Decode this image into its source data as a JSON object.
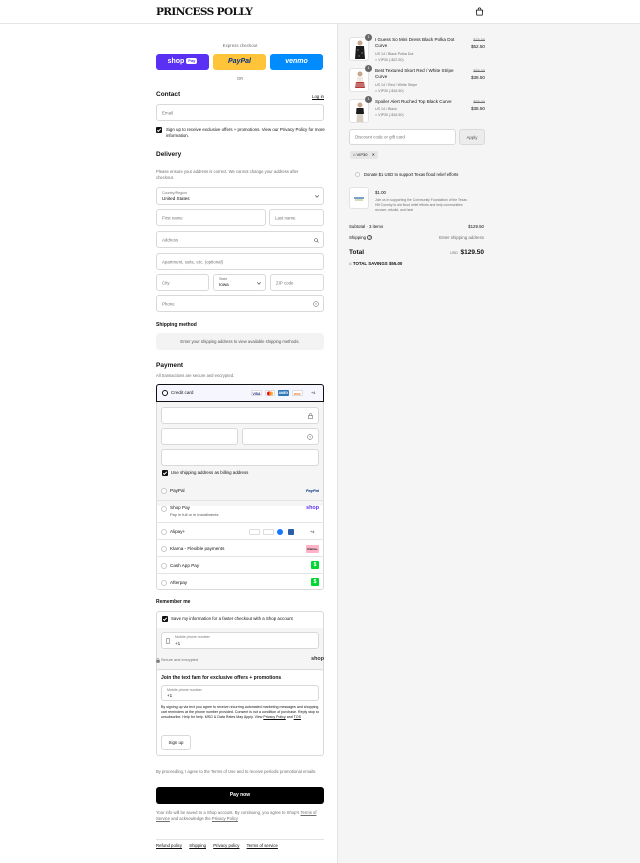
{
  "brand": {
    "logo": "PRINCESS POLLY"
  },
  "express": {
    "label": "Express checkout",
    "shop_pay": "shop",
    "shop_pay_badge": "Pay",
    "paypal": "PayPal",
    "venmo": "venmo",
    "or": "OR"
  },
  "contact": {
    "title": "Contact",
    "login": "Log in",
    "email_placeholder": "Email",
    "newsletter": "Sign up to receive exclusive offers + promotions. View our Privacy Policy for more information."
  },
  "delivery": {
    "title": "Delivery",
    "note": "Please ensure your address is correct. We cannot change your address after checkout.",
    "country_label": "Country/Region",
    "country_value": "United States",
    "first_name": "First name",
    "last_name": "Last name",
    "address": "Address",
    "apartment": "Apartment, suite, etc. (optional)",
    "city": "City",
    "state_label": "State",
    "state_value": "Iowa",
    "zip": "ZIP code",
    "phone": "Phone"
  },
  "shipping": {
    "title": "Shipping method",
    "placeholder": "Enter your shipping address to view available shipping methods."
  },
  "payment": {
    "title": "Payment",
    "note": "All transactions are secure and encrypted.",
    "credit_card": "Credit card",
    "card_badges": [
      "VISA",
      "MC",
      "AMEX",
      "DISC"
    ],
    "more_cards": "+4",
    "billing_same": "Use shipping address as billing address",
    "methods": [
      {
        "name": "PayPal",
        "badge": "PayPal"
      },
      {
        "name": "Shop Pay",
        "sub": "Pay in full or in installments",
        "badge": "shop"
      },
      {
        "name": "Alipay+",
        "more": "+4"
      },
      {
        "name": "Klarna - Flexible payments",
        "badge": "Klarna."
      },
      {
        "name": "Cash App Pay",
        "badge": "$"
      },
      {
        "name": "Afterpay",
        "badge": "$"
      }
    ]
  },
  "remember": {
    "title": "Remember me",
    "save_info": "Save my information for a faster checkout with a Shop account",
    "mobile_label": "Mobile phone number",
    "mobile_value": "+1",
    "secure": "Secure and encrypted",
    "shop": "shop"
  },
  "textfam": {
    "title": "Join the text fam for exclusive offers + promotions",
    "mobile_label": "Mobile phone number",
    "mobile_value": "+1",
    "legal_1": "By signing up via text you agree to receive recurring automated marketing messages and shopping cart reminders at the phone number provided. Consent is not a condition of purchase. Reply stop to unsubscribe. Help for help. MSG & Data Rates May Apply. View",
    "privacy": "Privacy Policy",
    "and": "and",
    "tos": "TOS",
    "signup": "Sign up"
  },
  "terms": "By proceeding, I agree to the Terms of Use and to receive periodic promotional emails.",
  "pay_now": "Pay now",
  "shop_note_1": "Your info will be saved to a Shop account. By continuing, you agree to Shop's",
  "shop_tos": "Terms of Service",
  "shop_note_2": "and acknowledge the",
  "shop_privacy": "Privacy Policy",
  "footer": [
    "Refund policy",
    "Shipping",
    "Privacy policy",
    "Terms of service"
  ],
  "cart": {
    "items": [
      {
        "qty": "1",
        "title": "I Guess So Mini Dress Black Polka Dot Curve",
        "variant": "US 14 / Black Polka Dot",
        "code": "VIP30 (-$22.50)",
        "old_price": "$75.00",
        "price": "$52.50"
      },
      {
        "qty": "1",
        "title": "Best Textured Skort Red / White Stripe Curve",
        "variant": "US 14 / Red / White Stripe",
        "code": "VIP30 (-$16.50)",
        "old_price": "$55.00",
        "price": "$38.50"
      },
      {
        "qty": "1",
        "title": "Spoiler Alert Ruched Top Black Curve",
        "variant": "US 14 / Black",
        "code": "VIP30 (-$16.50)",
        "old_price": "$55.00",
        "price": "$38.50"
      }
    ],
    "discount_placeholder": "Discount code or gift card",
    "apply": "Apply",
    "code_tag": "VIP30",
    "donate_label": "Donate $1 USD to support Texas flood relief efforts",
    "donate_price": "$1.00",
    "donate_text": "Join us in supporting the Community Foundation of the Texas Hill Country to aid flood relief efforts and help communities recover, rebuild, and heal",
    "subtotal_label": "Subtotal · 3 items",
    "subtotal": "$129.50",
    "shipping_label": "Shipping",
    "shipping_value": "Enter shipping address",
    "total_label": "Total",
    "currency": "USD",
    "total": "$129.50",
    "savings_label": "TOTAL SAVINGS",
    "savings": "$55.00"
  },
  "colors": {
    "shop_pay": "#5a31f4",
    "paypal": "#ffc439",
    "venmo": "#008cff",
    "cashapp": "#00d632",
    "klarna": "#ffb3c7"
  }
}
